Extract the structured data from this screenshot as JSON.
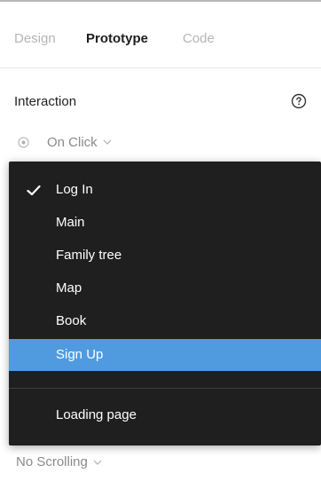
{
  "tabs": {
    "design": "Design",
    "prototype": "Prototype",
    "code": "Code"
  },
  "interaction": {
    "title": "Interaction",
    "trigger": "On Click"
  },
  "menu": {
    "items": [
      {
        "label": "Log In",
        "checked": true
      },
      {
        "label": "Main"
      },
      {
        "label": "Family tree"
      },
      {
        "label": "Map"
      },
      {
        "label": "Book"
      },
      {
        "label": "Sign Up",
        "highlighted": true
      },
      {
        "label": "Loading page"
      }
    ]
  },
  "overflow": {
    "label": "No Scrolling"
  },
  "colors": {
    "highlight": "#509be0",
    "menu_bg": "#1f1f1f",
    "muted_text": "#8a8a8a"
  }
}
